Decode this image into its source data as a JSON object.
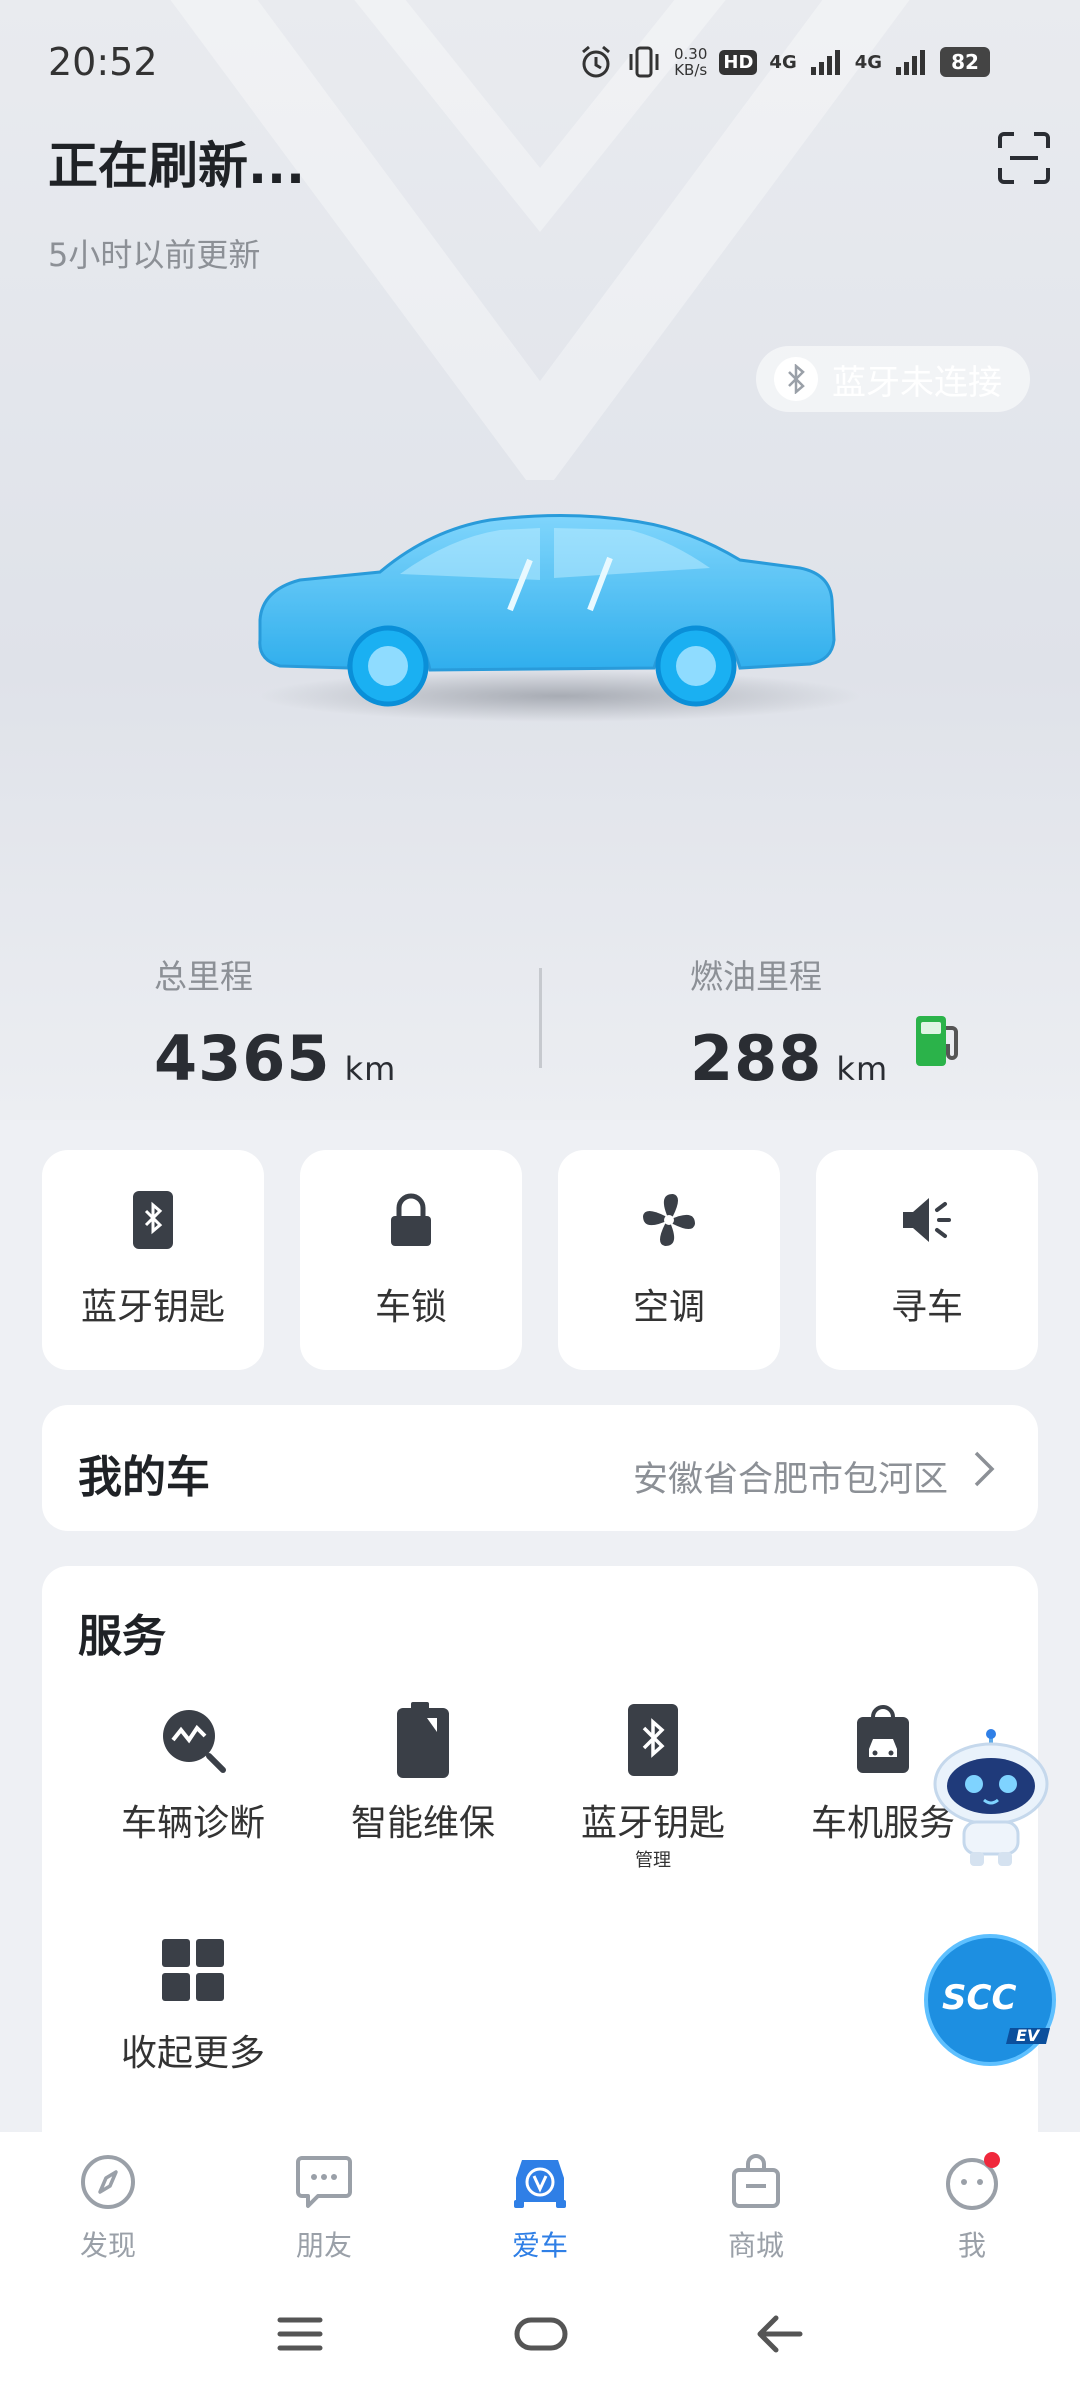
{
  "status_bar": {
    "time": "20:52",
    "net_speed_top": "0.30",
    "net_speed_bottom": "KB/s",
    "sim1": "4G",
    "sim2": "4G",
    "hd": "HD",
    "battery": "82"
  },
  "header": {
    "title": "正在刷新...",
    "subtitle": "5小时以前更新",
    "bluetooth_status": "蓝牙未连接"
  },
  "mileage": {
    "total_label": "总里程",
    "total_value": "4365",
    "total_unit": "km",
    "fuel_label": "燃油里程",
    "fuel_value": "288",
    "fuel_unit": "km"
  },
  "quick_actions": [
    {
      "label": "蓝牙钥匙",
      "icon": "bluetooth-key-icon"
    },
    {
      "label": "车锁",
      "icon": "lock-icon"
    },
    {
      "label": "空调",
      "icon": "fan-icon"
    },
    {
      "label": "寻车",
      "icon": "horn-icon"
    }
  ],
  "my_car": {
    "title": "我的车",
    "location": "安徽省合肥市包河区"
  },
  "services": {
    "title": "服务",
    "items": [
      {
        "label": "车辆诊断",
        "icon": "diagnosis-icon"
      },
      {
        "label": "智能维保",
        "icon": "maintenance-icon"
      },
      {
        "label": "蓝牙钥匙",
        "sub": "管理",
        "icon": "bluetooth-key-icon"
      },
      {
        "label": "车机服务",
        "icon": "car-service-icon"
      },
      {
        "label": "收起更多",
        "icon": "grid-icon"
      }
    ]
  },
  "badges": {
    "scc": "SCC",
    "ev": "EV"
  },
  "tabs": [
    {
      "label": "发现",
      "icon": "compass-icon",
      "active": false
    },
    {
      "label": "朋友",
      "icon": "chat-icon",
      "active": false
    },
    {
      "label": "爱车",
      "icon": "car-tab-icon",
      "active": true
    },
    {
      "label": "商城",
      "icon": "bag-icon",
      "active": false
    },
    {
      "label": "我",
      "icon": "face-icon",
      "active": false
    }
  ],
  "colors": {
    "accent": "#2f7fe6",
    "icon_dark": "#3a3f47",
    "fuel_green": "#2bb34a",
    "badge_red": "#f0283c"
  }
}
